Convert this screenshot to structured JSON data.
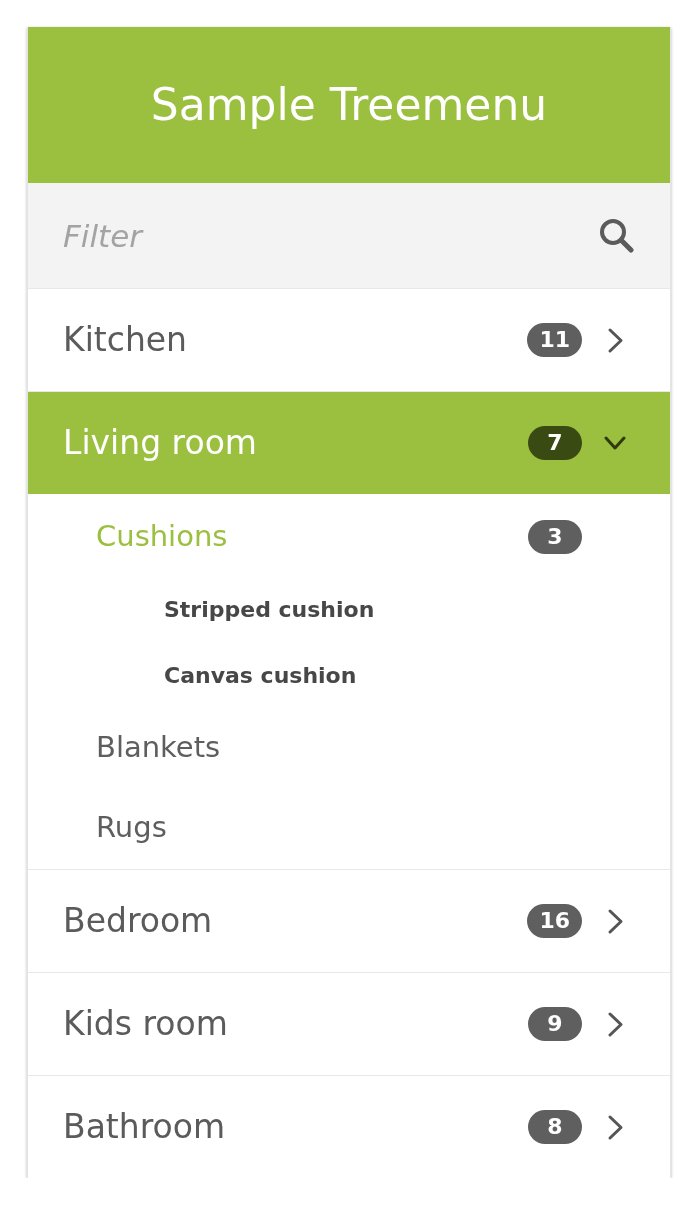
{
  "title": "Sample Treemenu",
  "filter": {
    "placeholder": "Filter"
  },
  "items": [
    {
      "label": "Kitchen",
      "count": "11",
      "selected": false,
      "expanded": false
    },
    {
      "label": "Living room",
      "count": "7",
      "selected": true,
      "expanded": true,
      "children": [
        {
          "label": "Cushions",
          "count": "3",
          "selected": true,
          "children": [
            {
              "label": "Stripped cushion",
              "selected": false
            },
            {
              "label": "Canvas cushion",
              "selected": false
            }
          ]
        },
        {
          "label": "Blankets",
          "selected": false
        },
        {
          "label": "Rugs",
          "selected": false
        }
      ]
    },
    {
      "label": "Bedroom",
      "count": "16",
      "selected": false,
      "expanded": false
    },
    {
      "label": "Kids room",
      "count": "9",
      "selected": false,
      "expanded": false
    },
    {
      "label": "Bathroom",
      "count": "8",
      "selected": false,
      "expanded": false
    }
  ]
}
